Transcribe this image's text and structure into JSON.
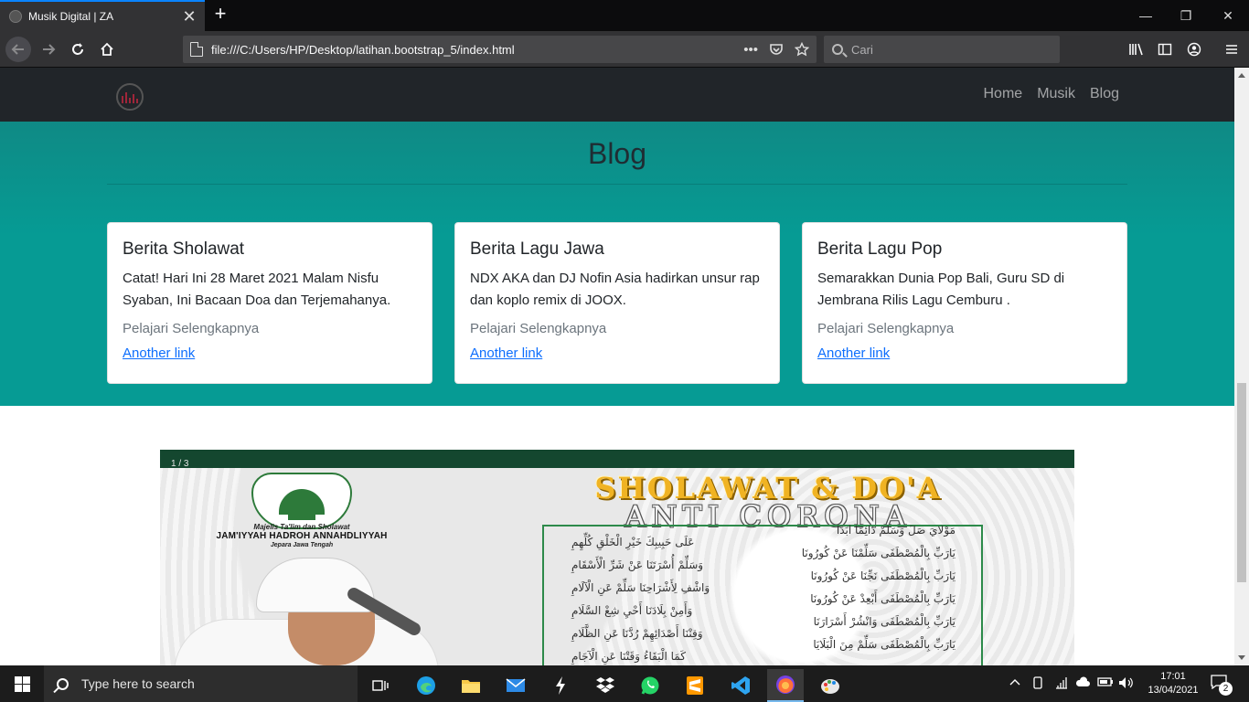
{
  "browser": {
    "tab_title": "Musik Digital | ZA",
    "tab_close": "✕",
    "new_tab": "+",
    "url": "file:///C:/Users/HP/Desktop/latihan.bootstrap_5/index.html",
    "page_actions": "•••",
    "search_placeholder": "Cari",
    "win_minimize": "—",
    "win_restore": "❐",
    "win_close": "✕"
  },
  "site": {
    "nav": {
      "items": [
        "Home",
        "Musik",
        "Blog"
      ]
    },
    "blog": {
      "title": "Blog",
      "cards": [
        {
          "title": "Berita Sholawat",
          "text": "Catat! Hari Ini 28 Maret 2021 Malam Nisfu Syaban, Ini Bacaan Doa dan Terjemahanya.",
          "subtitle": "Pelajari Selengkapnya",
          "link": "Another link"
        },
        {
          "title": "Berita Lagu Jawa",
          "text": "NDX AKA dan DJ Nofin Asia hadirkan unsur rap dan koplo remix di JOOX.",
          "subtitle": "Pelajari Selengkapnya",
          "link": "Another link"
        },
        {
          "title": "Berita Lagu Pop",
          "text": "Semarakkan Dunia Pop Bali, Guru SD di Jembrana Rilis Lagu Cemburu .",
          "subtitle": "Pelajari Selengkapnya",
          "link": "Another link"
        }
      ]
    },
    "carousel": {
      "counter": "1 / 3",
      "slide": {
        "org_line1": "Majelis Ta'lim dan Sholawat",
        "org_line2": "JAM'IYYAH HADROH ANNAHDLIYYAH",
        "org_line3": "Jepara Jawa Tengah",
        "title_line1": "SHOLAWAT & DO'A",
        "title_line2": "ANTI CORONA",
        "arabic_lines": [
          "مَوْلَايَ صَلِّ وَسَلِّمْ دَائِمًا أَبَدًا",
          "عَلَى حَبِيبِكَ خَيْرِ الْخَلْقِ كُلِّهِمِ",
          "يَارَبِّ بِالْمُصْطَفَى سَلِّمْنَا عَنْ كُورُونَا",
          "وَسَلِّمْ أُسْرَتَنَا عَنْ شَرِّ الْأَسْقَامِ",
          "يَارَبِّ بِالْمُصْطَفَى نَجِّنَا عَنْ كُورُونَا",
          "وَاشْفِ لِأَشْرَاحِنَا سَلِّمْ عَنِ الْآلَامِ",
          "يَارَبِّ بِالْمُصْطَفَى أَبْعِدْ عَنْ كُورُونَا",
          "وَأَمِنْ بِلَادَنَا أَحْيِ شِعْ السَّلَامِ",
          "يَارَبِّ بِالْمُصْطَفَى وَانْشُرْ أَسْرَارَنَا",
          "وَقِنْنَا أَصْدَائِهِمْ رُدَّنَا عَنِ الظَّلَامِ",
          "يَارَبِّ بِالْمُصْطَفَى سَلِّمْ مِنَ الْبَلَايَا",
          "كَمَا الْبَقَاءُ وَقَتْنَا عَنِ الْآجَامِ"
        ]
      }
    }
  },
  "taskbar": {
    "search_text": "Type here to search",
    "time": "17:01",
    "date": "13/04/2021",
    "notification_count": "2"
  },
  "colors": {
    "site_nav_bg": "#212529",
    "blog_section_bg": "#069b94",
    "link": "#0d6efd",
    "browser_accent": "#0a84ff"
  }
}
